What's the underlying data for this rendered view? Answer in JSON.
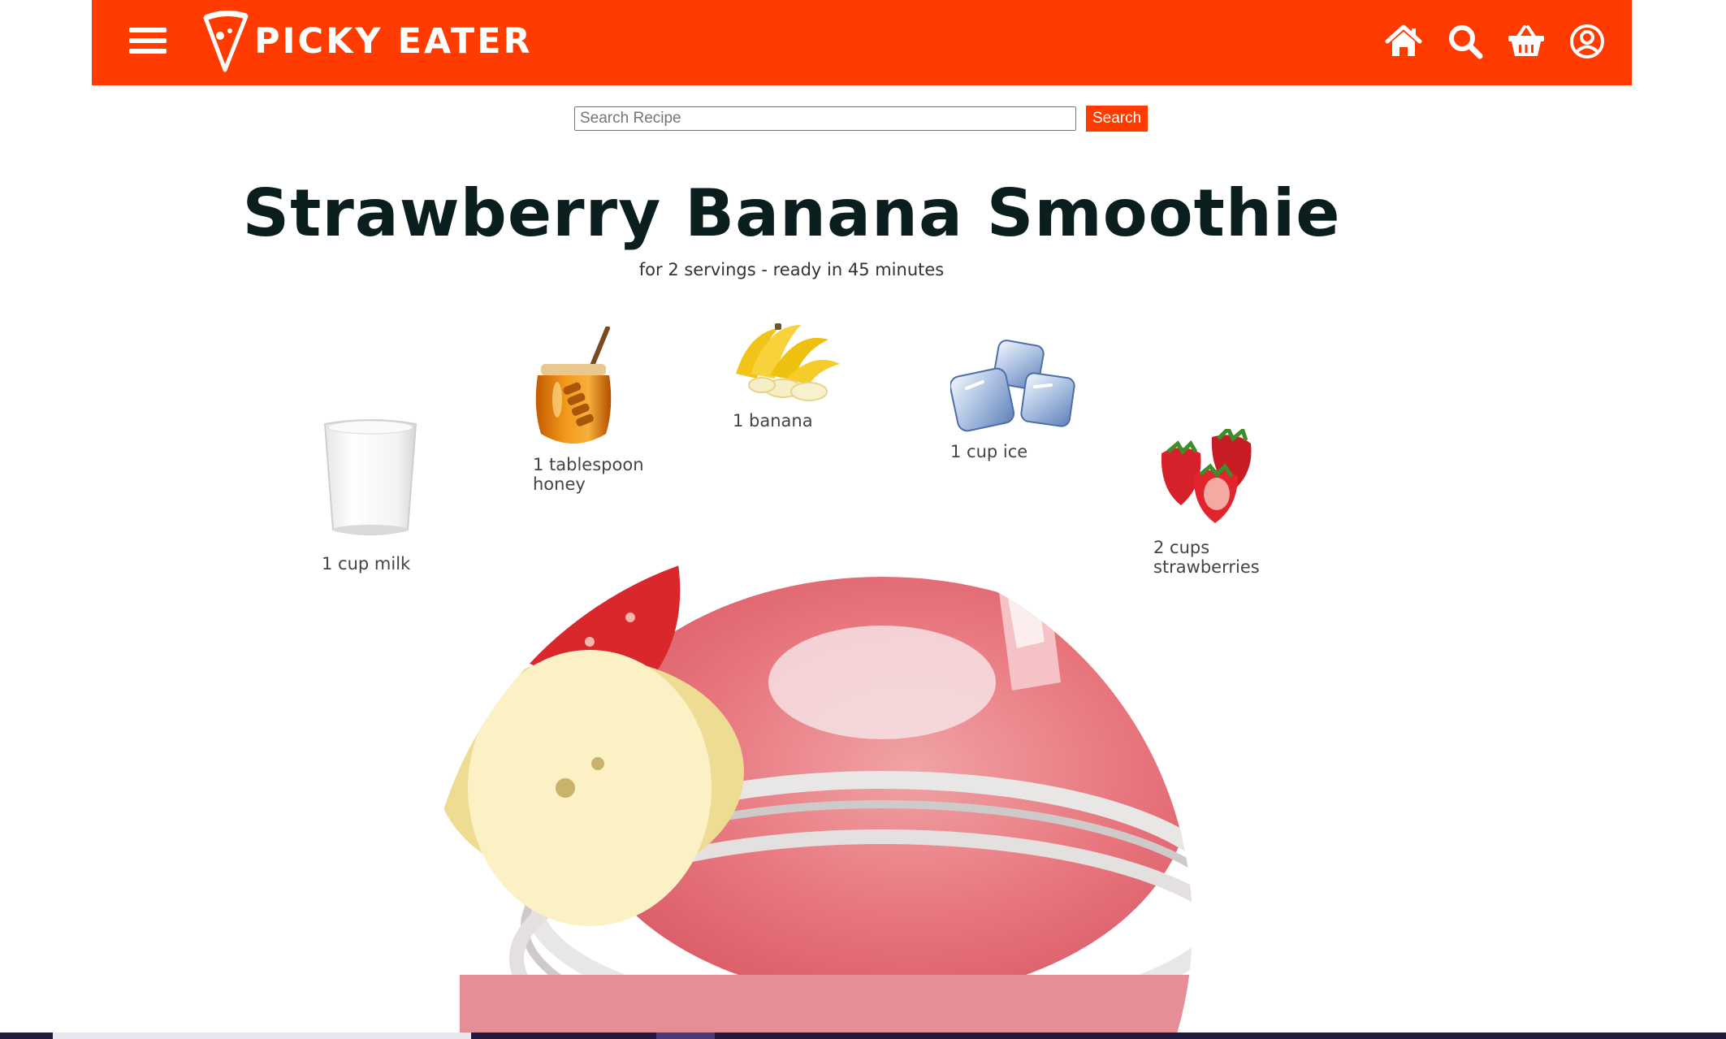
{
  "brand": {
    "name": "PICKY EATER",
    "accent_color": "#ff3b00"
  },
  "header": {
    "icons": [
      "menu-icon",
      "home-icon",
      "search-icon",
      "basket-icon",
      "user-icon"
    ]
  },
  "search": {
    "placeholder": "Search Recipe",
    "value": "",
    "button_label": "Search"
  },
  "recipe": {
    "title": "Strawberry Banana Smoothie",
    "subtitle": "for 2 servings - ready in 45 minutes",
    "ingredients": [
      {
        "label": "1 cup milk",
        "icon": "milk-glass-icon"
      },
      {
        "label": "1 tablespoon honey",
        "icon": "honey-jar-icon"
      },
      {
        "label": "1  banana",
        "icon": "banana-icon"
      },
      {
        "label": "1 cup ice",
        "icon": "ice-cubes-icon"
      },
      {
        "label": "2 cups strawberries",
        "icon": "strawberries-icon"
      }
    ],
    "hero_image": "strawberry-banana-smoothie-image"
  }
}
